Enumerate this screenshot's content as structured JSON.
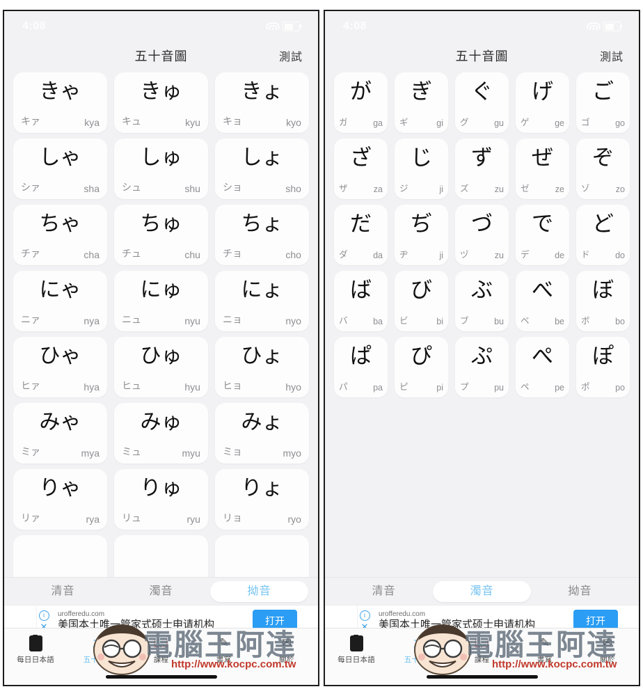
{
  "status_bar": {
    "time": "4:08",
    "wifi_icon": "wifi-icon",
    "battery_icon": "battery-icon"
  },
  "nav": {
    "title": "五十音圖",
    "action": "測試"
  },
  "segment": {
    "options": [
      "清音",
      "濁音",
      "拗音"
    ]
  },
  "panels": [
    {
      "id": "left",
      "selected_segment": "拗音",
      "columns": 3,
      "cards": [
        {
          "kana": "きゃ",
          "kata": "キァ",
          "romaji": "kya"
        },
        {
          "kana": "きゅ",
          "kata": "キュ",
          "romaji": "kyu"
        },
        {
          "kana": "きょ",
          "kata": "キョ",
          "romaji": "kyo"
        },
        {
          "kana": "しゃ",
          "kata": "シァ",
          "romaji": "sha"
        },
        {
          "kana": "しゅ",
          "kata": "シュ",
          "romaji": "shu"
        },
        {
          "kana": "しょ",
          "kata": "ショ",
          "romaji": "sho"
        },
        {
          "kana": "ちゃ",
          "kata": "チァ",
          "romaji": "cha"
        },
        {
          "kana": "ちゅ",
          "kata": "チュ",
          "romaji": "chu"
        },
        {
          "kana": "ちょ",
          "kata": "チョ",
          "romaji": "cho"
        },
        {
          "kana": "にゃ",
          "kata": "ニァ",
          "romaji": "nya"
        },
        {
          "kana": "にゅ",
          "kata": "ニュ",
          "romaji": "nyu"
        },
        {
          "kana": "にょ",
          "kata": "ニョ",
          "romaji": "nyo"
        },
        {
          "kana": "ひゃ",
          "kata": "ヒァ",
          "romaji": "hya"
        },
        {
          "kana": "ひゅ",
          "kata": "ヒュ",
          "romaji": "hyu"
        },
        {
          "kana": "ひょ",
          "kata": "ヒョ",
          "romaji": "hyo"
        },
        {
          "kana": "みゃ",
          "kata": "ミァ",
          "romaji": "mya"
        },
        {
          "kana": "みゅ",
          "kata": "ミュ",
          "romaji": "myu"
        },
        {
          "kana": "みょ",
          "kata": "ミョ",
          "romaji": "myo"
        },
        {
          "kana": "りゃ",
          "kata": "リァ",
          "romaji": "rya"
        },
        {
          "kana": "りゅ",
          "kata": "リュ",
          "romaji": "ryu"
        },
        {
          "kana": "りょ",
          "kata": "リョ",
          "romaji": "ryo"
        },
        {
          "kana": "",
          "kata": "",
          "romaji": ""
        },
        {
          "kana": "",
          "kata": "",
          "romaji": ""
        },
        {
          "kana": "",
          "kata": "",
          "romaji": ""
        }
      ]
    },
    {
      "id": "right",
      "selected_segment": "濁音",
      "columns": 5,
      "cards": [
        {
          "kana": "が",
          "kata": "ガ",
          "romaji": "ga"
        },
        {
          "kana": "ぎ",
          "kata": "ギ",
          "romaji": "gi"
        },
        {
          "kana": "ぐ",
          "kata": "グ",
          "romaji": "gu"
        },
        {
          "kana": "げ",
          "kata": "ゲ",
          "romaji": "ge"
        },
        {
          "kana": "ご",
          "kata": "ゴ",
          "romaji": "go"
        },
        {
          "kana": "ざ",
          "kata": "ザ",
          "romaji": "za"
        },
        {
          "kana": "じ",
          "kata": "ジ",
          "romaji": "ji"
        },
        {
          "kana": "ず",
          "kata": "ズ",
          "romaji": "zu"
        },
        {
          "kana": "ぜ",
          "kata": "ゼ",
          "romaji": "ze"
        },
        {
          "kana": "ぞ",
          "kata": "ゾ",
          "romaji": "zo"
        },
        {
          "kana": "だ",
          "kata": "ダ",
          "romaji": "da"
        },
        {
          "kana": "ぢ",
          "kata": "ヂ",
          "romaji": "ji"
        },
        {
          "kana": "づ",
          "kata": "ヅ",
          "romaji": "zu"
        },
        {
          "kana": "で",
          "kata": "デ",
          "romaji": "de"
        },
        {
          "kana": "ど",
          "kata": "ド",
          "romaji": "do"
        },
        {
          "kana": "ば",
          "kata": "バ",
          "romaji": "ba"
        },
        {
          "kana": "び",
          "kata": "ビ",
          "romaji": "bi"
        },
        {
          "kana": "ぶ",
          "kata": "ブ",
          "romaji": "bu"
        },
        {
          "kana": "べ",
          "kata": "ベ",
          "romaji": "be"
        },
        {
          "kana": "ぼ",
          "kata": "ボ",
          "romaji": "bo"
        },
        {
          "kana": "ぱ",
          "kata": "パ",
          "romaji": "pa"
        },
        {
          "kana": "ぴ",
          "kata": "ピ",
          "romaji": "pi"
        },
        {
          "kana": "ぷ",
          "kata": "プ",
          "romaji": "pu"
        },
        {
          "kana": "ぺ",
          "kata": "ペ",
          "romaji": "pe"
        },
        {
          "kana": "ぽ",
          "kata": "ポ",
          "romaji": "po"
        }
      ]
    }
  ],
  "ad": {
    "domain": "urofferedu.com",
    "headline": "美国本土唯一管家式硕士申请机构",
    "button": "打开",
    "info_icon": "info-icon",
    "close_icon": "close-icon"
  },
  "tabbar": {
    "items": [
      {
        "label": "每日日本語",
        "icon": "clipboard-icon",
        "active": false
      },
      {
        "label": "五十音圖",
        "icon": "kana-a-icon",
        "active": true
      },
      {
        "label": "課程",
        "icon": "book-icon",
        "active": false
      },
      {
        "label": "書寫",
        "icon": "pen-icon",
        "active": false
      },
      {
        "label": "關於",
        "icon": "info-circle-icon",
        "active": false
      }
    ]
  },
  "watermark": {
    "text": "電腦王阿達",
    "url": "http://www.kocpc.com.tw"
  },
  "colors": {
    "accent": "#64bdf0",
    "ad_button": "#2b9df4",
    "page_bg": "#f2f2f4",
    "card_bg": "#fdfdfd",
    "sub_text": "#8e8e93",
    "watermark_text": "#5d6b79",
    "watermark_url": "#c0392b"
  }
}
